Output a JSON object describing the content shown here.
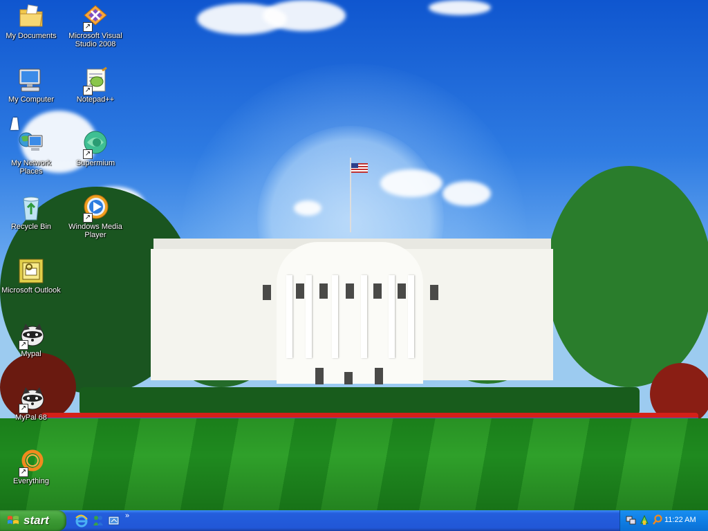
{
  "desktop": {
    "icons": [
      {
        "id": "my-documents",
        "label": "My Documents",
        "shortcut": false
      },
      {
        "id": "ms-visual-studio",
        "label": "Microsoft Visual Studio 2008",
        "shortcut": true
      },
      {
        "id": "my-computer",
        "label": "My Computer",
        "shortcut": false
      },
      {
        "id": "notepad-plus-plus",
        "label": "Notepad++",
        "shortcut": true
      },
      {
        "id": "my-network-places",
        "label": "My Network Places",
        "shortcut": false
      },
      {
        "id": "supermium",
        "label": "Supermium",
        "shortcut": true
      },
      {
        "id": "recycle-bin",
        "label": "Recycle Bin",
        "shortcut": false
      },
      {
        "id": "windows-media-player",
        "label": "Windows Media Player",
        "shortcut": true
      },
      {
        "id": "microsoft-outlook",
        "label": "Microsoft Outlook",
        "shortcut": false
      },
      {
        "id": "mypal",
        "label": "Mypal",
        "shortcut": true
      },
      {
        "id": "mypal-68",
        "label": "MyPal 68",
        "shortcut": true
      },
      {
        "id": "everything",
        "label": "Everything",
        "shortcut": true
      }
    ]
  },
  "taskbar": {
    "start_label": "start",
    "quick_launch": [
      "internet-explorer-icon",
      "messenger-icon",
      "show-desktop-icon"
    ],
    "chevron": "»",
    "clock": "11:22 AM"
  },
  "tray": {
    "icons": [
      "network-icon",
      "safely-remove-icon",
      "search-icon"
    ]
  }
}
